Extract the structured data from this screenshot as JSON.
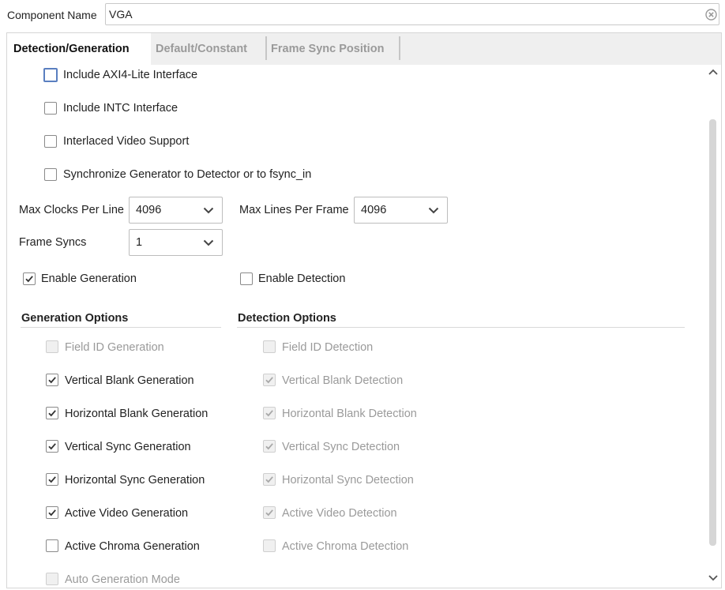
{
  "component": {
    "label": "Component Name",
    "value": "VGA"
  },
  "tabs": [
    {
      "label": "Detection/Generation"
    },
    {
      "label": "Default/Constant"
    },
    {
      "label": "Frame Sync Position"
    }
  ],
  "options": [
    {
      "label": "Include AXI4-Lite Interface",
      "checked": false
    },
    {
      "label": "Include INTC Interface",
      "checked": false
    },
    {
      "label": "Interlaced Video Support",
      "checked": false
    },
    {
      "label": "Synchronize Generator to Detector or to fsync_in",
      "checked": false
    }
  ],
  "fields": {
    "max_clocks": {
      "label": "Max Clocks Per Line",
      "value": "4096"
    },
    "max_lines": {
      "label": "Max Lines Per Frame",
      "value": "4096"
    },
    "frame_syncs": {
      "label": "Frame Syncs",
      "value": "1"
    }
  },
  "enable_generation": {
    "label": "Enable Generation",
    "checked": true
  },
  "enable_detection": {
    "label": "Enable Detection",
    "checked": false
  },
  "generation": {
    "title": "Generation Options",
    "items": [
      {
        "label": "Field ID Generation",
        "checked": false,
        "disabled": true
      },
      {
        "label": "Vertical Blank Generation",
        "checked": true,
        "disabled": false
      },
      {
        "label": "Horizontal Blank Generation",
        "checked": true,
        "disabled": false
      },
      {
        "label": "Vertical Sync Generation",
        "checked": true,
        "disabled": false
      },
      {
        "label": "Horizontal Sync Generation",
        "checked": true,
        "disabled": false
      },
      {
        "label": "Active Video Generation",
        "checked": true,
        "disabled": false
      },
      {
        "label": "Active Chroma Generation",
        "checked": false,
        "disabled": false
      },
      {
        "label": "Auto Generation Mode",
        "checked": false,
        "disabled": true
      }
    ]
  },
  "detection": {
    "title": "Detection Options",
    "items": [
      {
        "label": "Field ID Detection",
        "checked": false,
        "disabled": true
      },
      {
        "label": "Vertical Blank Detection",
        "checked": true,
        "disabled": true
      },
      {
        "label": "Horizontal Blank Detection",
        "checked": true,
        "disabled": true
      },
      {
        "label": "Vertical Sync Detection",
        "checked": true,
        "disabled": true
      },
      {
        "label": "Horizontal Sync Detection",
        "checked": true,
        "disabled": true
      },
      {
        "label": "Active Video Detection",
        "checked": true,
        "disabled": true
      },
      {
        "label": "Active Chroma Detection",
        "checked": false,
        "disabled": true
      }
    ]
  }
}
